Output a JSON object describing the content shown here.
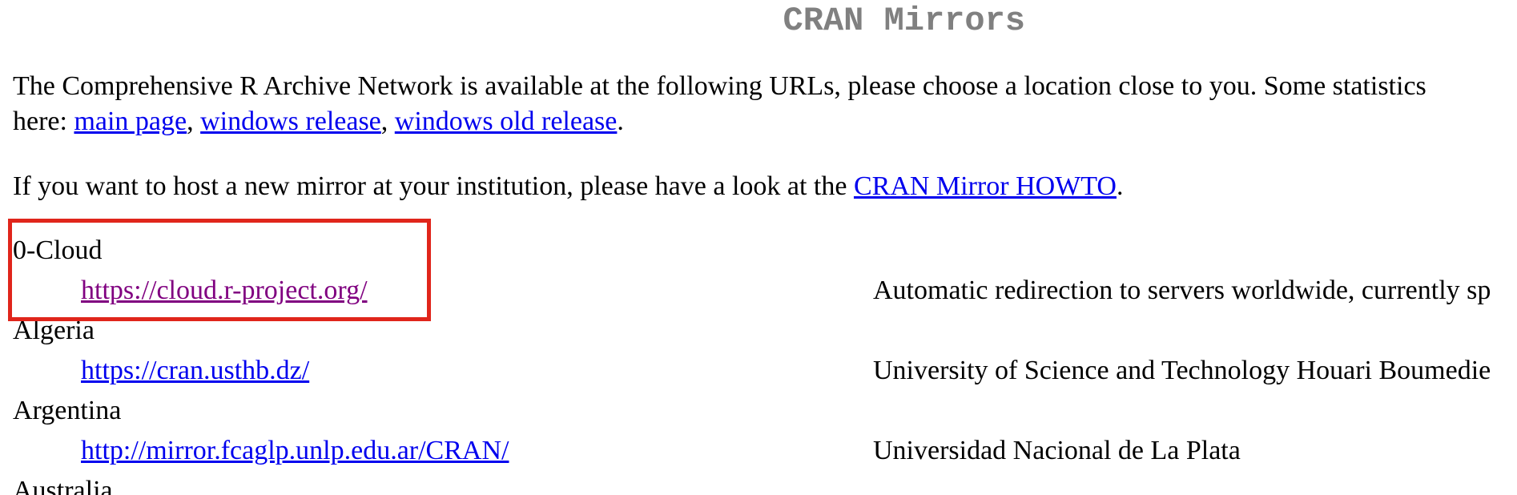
{
  "page": {
    "title": "CRAN Mirrors"
  },
  "intro": {
    "line1": "The Comprehensive R Archive Network is available at the following URLs, please choose a location close to you. Some statistics",
    "here_label": "here: ",
    "link_main": "main page",
    "comma1": ", ",
    "link_windows": "windows release",
    "comma2": ", ",
    "link_windows_old": "windows old release",
    "period": "."
  },
  "host": {
    "text": "If you want to host a new mirror at your institution, please have a look at the ",
    "link": "CRAN Mirror HOWTO",
    "period": "."
  },
  "mirrors": [
    {
      "country": "0-Cloud",
      "url": "https://cloud.r-project.org/",
      "description": "Automatic redirection to servers worldwide, currently sp",
      "visited": true
    },
    {
      "country": "Algeria",
      "url": "https://cran.usthb.dz/",
      "description": "University of Science and Technology Houari Boumedie",
      "visited": false
    },
    {
      "country": "Argentina",
      "url": "http://mirror.fcaglp.unlp.edu.ar/CRAN/",
      "description": "Universidad Nacional de La Plata",
      "visited": false
    },
    {
      "country": "Australia"
    }
  ],
  "colors": {
    "link": "#0000ee",
    "visited_link": "#800080",
    "title": "#808080",
    "highlight": "#e0251b"
  }
}
